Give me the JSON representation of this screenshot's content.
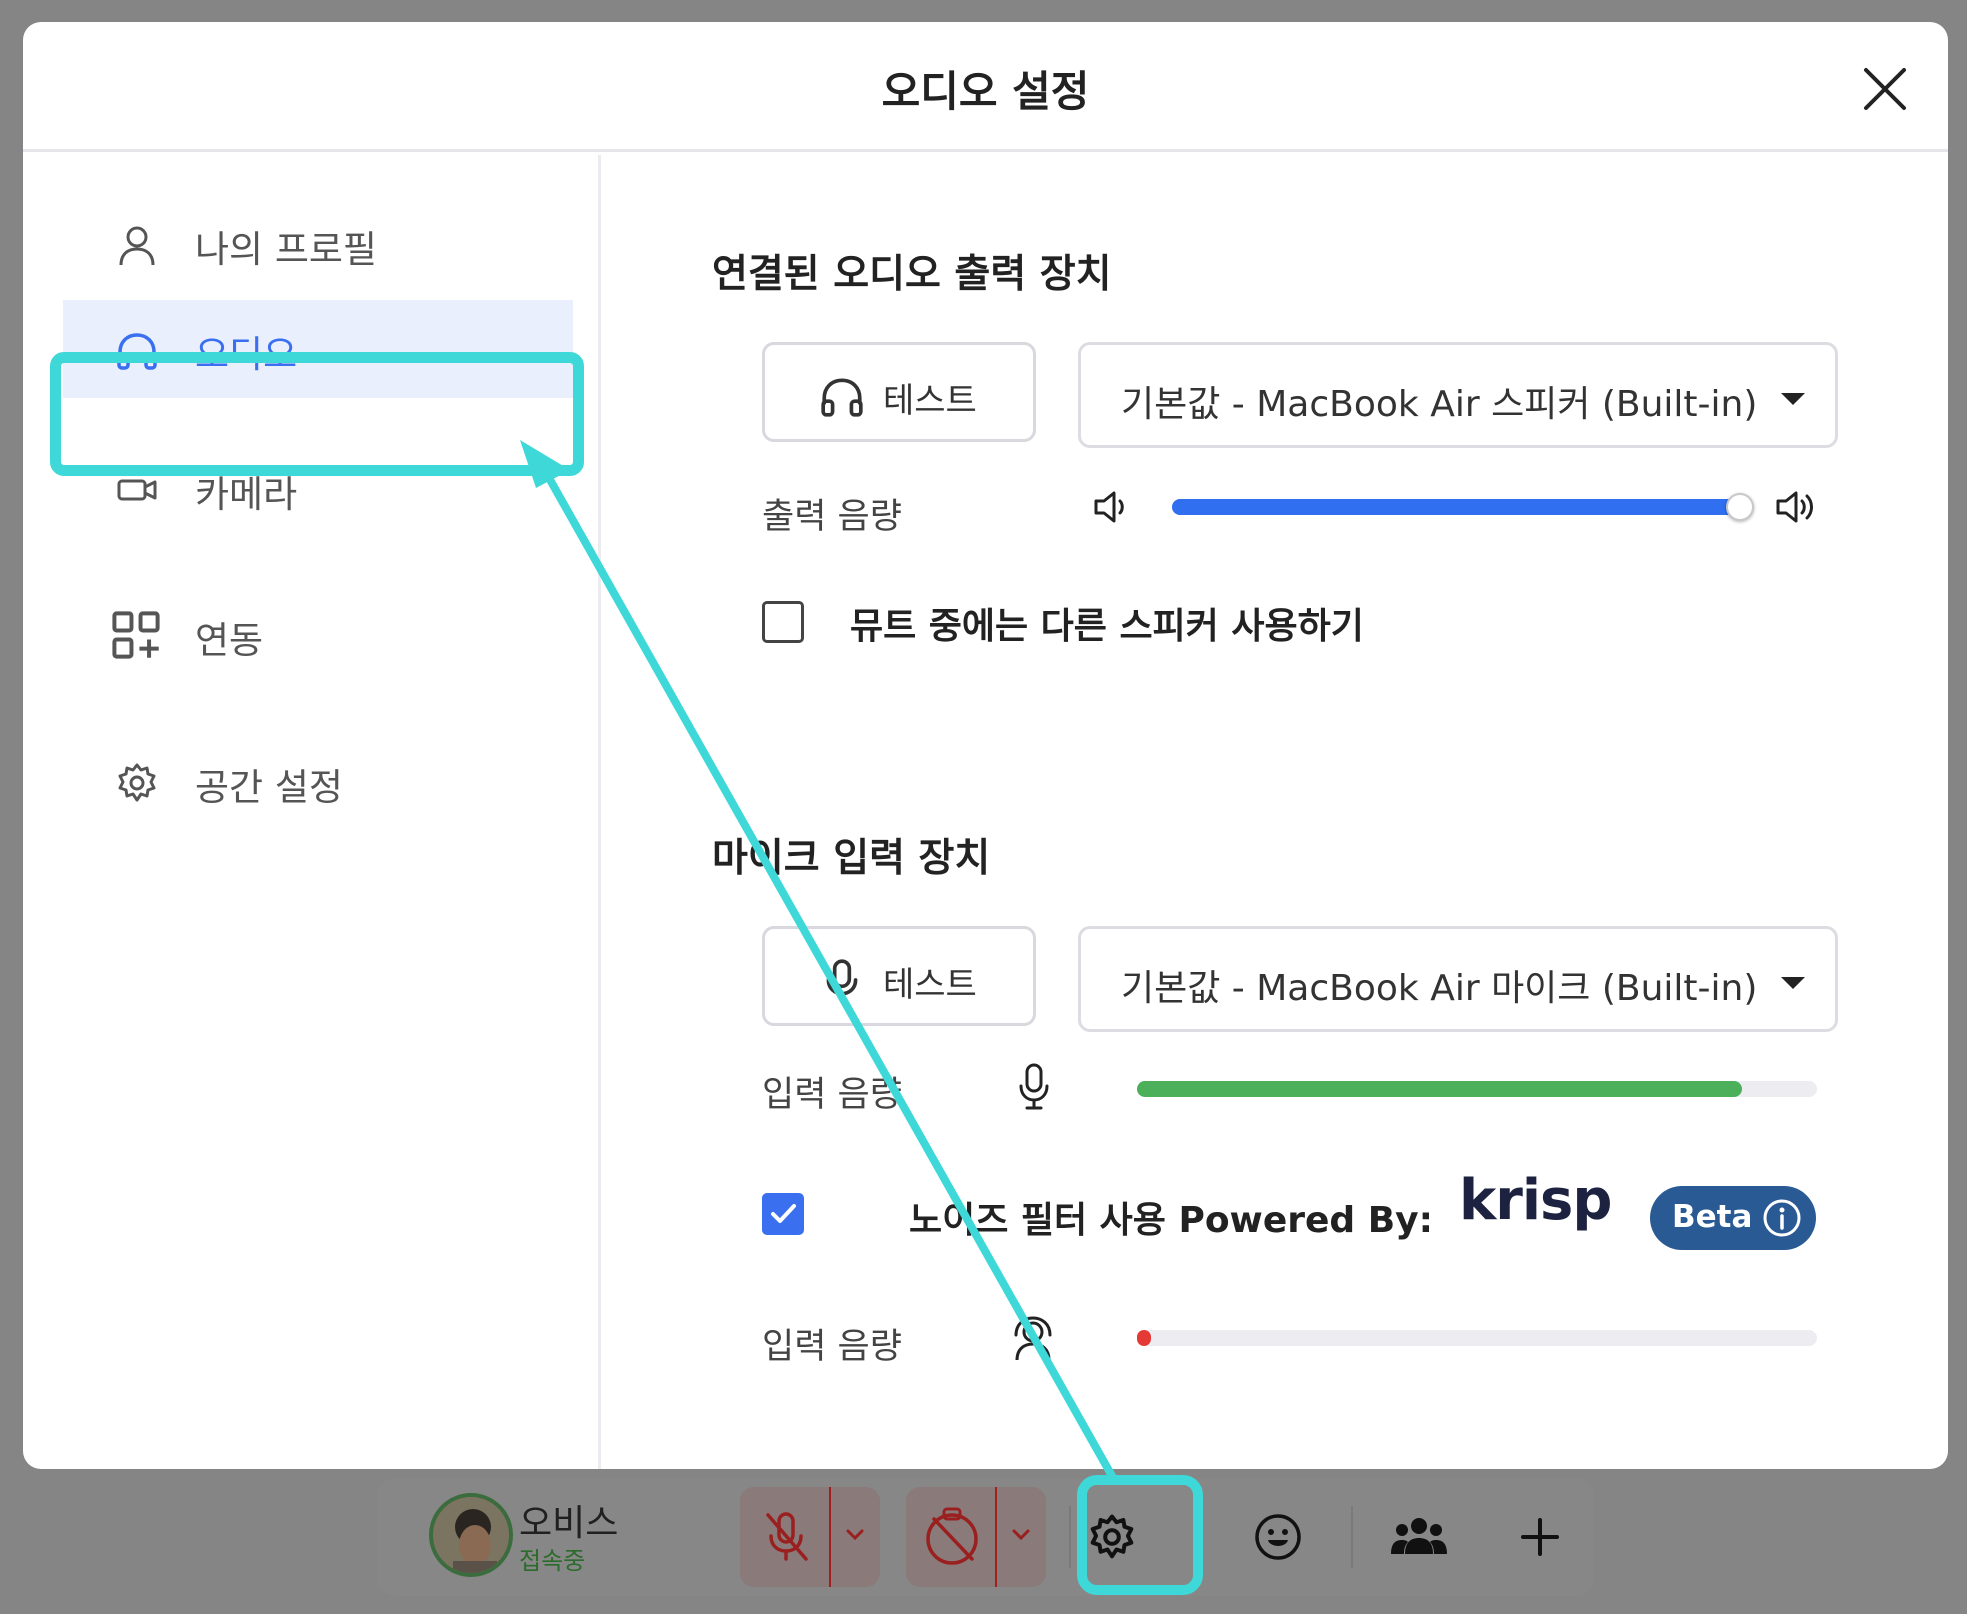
{
  "modal": {
    "title": "오디오 설정"
  },
  "sidebar": {
    "items": [
      {
        "label": "나의 프로필",
        "icon": "user-icon"
      },
      {
        "label": "오디오",
        "icon": "headphones-icon",
        "active": true
      },
      {
        "label": "카메라",
        "icon": "camera-icon"
      },
      {
        "label": "연동",
        "icon": "integration-icon"
      },
      {
        "label": "공간 설정",
        "icon": "gear-icon"
      }
    ]
  },
  "output": {
    "section_title": "연결된 오디오 출력 장치",
    "test_label": "테스트",
    "device": "기본값 - MacBook Air 스피커 (Built-in)",
    "volume_label": "출력 음량",
    "volume_level": 0.98,
    "mute_checkbox_label": "뮤트 중에는 다른 스피커 사용하기",
    "mute_checked": false
  },
  "input": {
    "section_title": "마이크 입력 장치",
    "test_label": "테스트",
    "device": "기본값 - MacBook Air 마이크 (Built-in)",
    "volume_label": "입력 음량",
    "volume_level": 0.89,
    "noise_filter_label": "노이즈 필터 사용 Powered By:",
    "noise_filter_checked": true,
    "krisp_logo": "krisp",
    "beta_label": "Beta",
    "filtered_volume_label": "입력 음량",
    "filtered_volume_level": 0.01
  },
  "toolbar": {
    "user_name": "오비스",
    "user_status": "접속중"
  },
  "colors": {
    "accent": "#3a6ff0",
    "highlight": "#3fd8d8",
    "output_fill": "#2f6ff0",
    "input_fill": "#4caf5a",
    "filtered_fill": "#e53935",
    "beta_bg": "#2a5a93"
  }
}
